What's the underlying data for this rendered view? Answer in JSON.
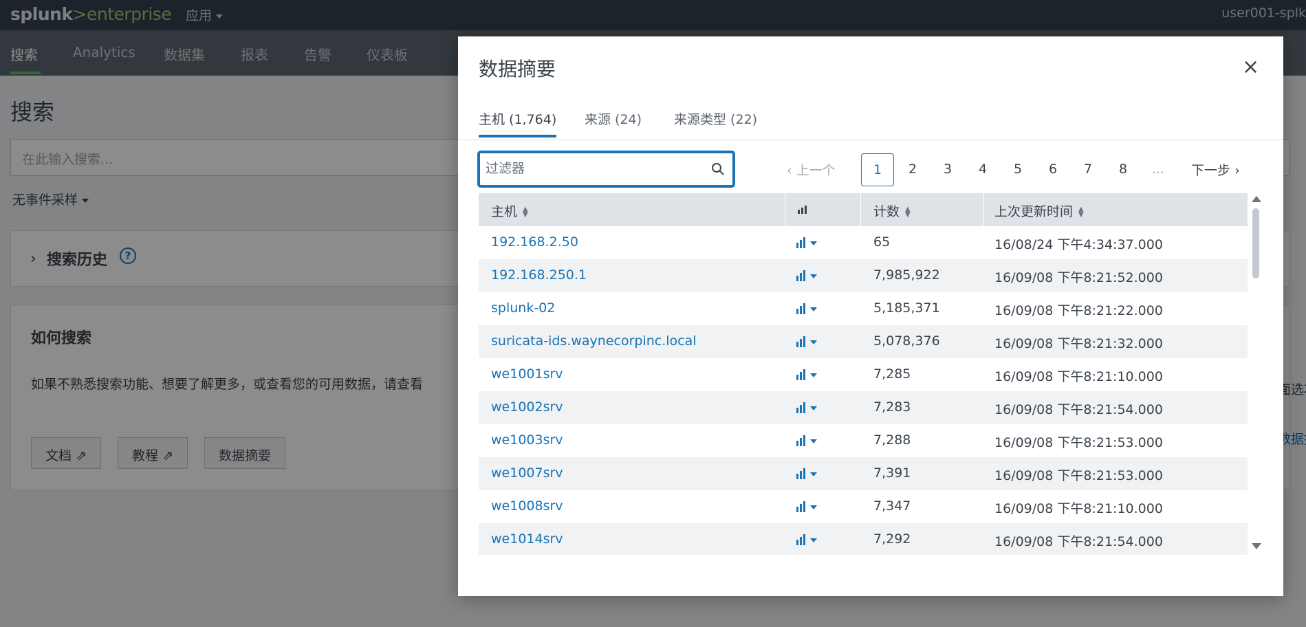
{
  "topbar": {
    "logo_a": "splunk",
    "logo_b": ">enterprise",
    "apps": "应用",
    "user": "user001-splk"
  },
  "nav": {
    "search": "搜索",
    "analytics": "Analytics",
    "datasets": "数据集",
    "reports": "报表",
    "alerts": "告警",
    "dashboards": "仪表板"
  },
  "page": {
    "title": "搜索",
    "search_placeholder": "在此输入搜索...",
    "sampling": "无事件采样",
    "history": "搜索历史",
    "how_title": "如何搜索",
    "how_text": "如果不熟悉搜索功能、想要了解更多，或查看您的可用数据，请查看",
    "right_text_1": "面选项",
    "right_text_2": "数据摘",
    "btn_docs": "文档",
    "btn_tutorial": "教程",
    "btn_summary": "数据摘要"
  },
  "modal": {
    "title": "数据摘要",
    "close": "×",
    "tabs": {
      "hosts": "主机 (1,764)",
      "sources": "来源 (24)",
      "sourcetypes": "来源类型 (22)"
    },
    "filter_placeholder": "过滤器",
    "pager": {
      "prev": "上一个",
      "next": "下一步",
      "pages": [
        "1",
        "2",
        "3",
        "4",
        "5",
        "6",
        "7",
        "8"
      ],
      "ellipsis": "...",
      "current": "1"
    },
    "columns": {
      "host": "主机",
      "count": "计数",
      "last_update": "上次更新时间"
    },
    "rows": [
      {
        "host": "192.168.2.50",
        "count": "65",
        "time": "16/08/24 下午4:34:37.000"
      },
      {
        "host": "192.168.250.1",
        "count": "7,985,922",
        "time": "16/09/08 下午8:21:52.000"
      },
      {
        "host": "splunk-02",
        "count": "5,185,371",
        "time": "16/09/08 下午8:21:22.000"
      },
      {
        "host": "suricata-ids.waynecorpinc.local",
        "count": "5,078,376",
        "time": "16/09/08 下午8:21:32.000"
      },
      {
        "host": "we1001srv",
        "count": "7,285",
        "time": "16/09/08 下午8:21:10.000"
      },
      {
        "host": "we1002srv",
        "count": "7,283",
        "time": "16/09/08 下午8:21:54.000"
      },
      {
        "host": "we1003srv",
        "count": "7,288",
        "time": "16/09/08 下午8:21:53.000"
      },
      {
        "host": "we1007srv",
        "count": "7,391",
        "time": "16/09/08 下午8:21:53.000"
      },
      {
        "host": "we1008srv",
        "count": "7,347",
        "time": "16/09/08 下午8:21:10.000"
      },
      {
        "host": "we1014srv",
        "count": "7,292",
        "time": "16/09/08 下午8:21:54.000"
      }
    ]
  },
  "colors": {
    "accent": "#1a73b5",
    "topbar": "#33404e",
    "navbar": "#5c6670",
    "logo_green": "#9fc97d",
    "nav_active": "#5cc05c"
  }
}
